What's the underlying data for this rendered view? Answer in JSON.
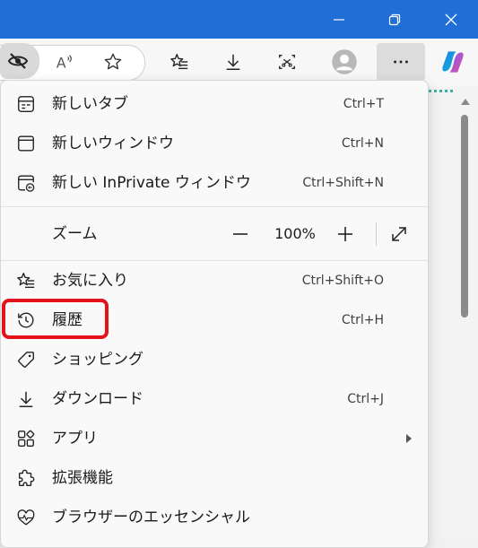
{
  "window": {
    "titlebar_color": "#1f6fd6",
    "buttons": [
      "minimize",
      "restore",
      "close"
    ]
  },
  "toolbar": {
    "icons": [
      "tracking-eye-icon",
      "read-aloud-icon",
      "favorite-star-icon",
      "favorites-list-icon",
      "download-icon",
      "screenshot-icon",
      "profile-avatar-icon",
      "more-options-icon",
      "copilot-icon"
    ],
    "read_aloud_label": "A"
  },
  "menu": {
    "items_top": [
      {
        "label": "新しいタブ",
        "shortcut": "Ctrl+T",
        "icon": "new-tab-icon"
      },
      {
        "label": "新しいウィンドウ",
        "shortcut": "Ctrl+N",
        "icon": "new-window-icon"
      },
      {
        "label": "新しい InPrivate ウィンドウ",
        "shortcut": "Ctrl+Shift+N",
        "icon": "inprivate-window-icon"
      }
    ],
    "zoom": {
      "label": "ズーム",
      "value": "100%"
    },
    "items_bottom": [
      {
        "label": "お気に入り",
        "shortcut": "Ctrl+Shift+O",
        "icon": "favorites-icon"
      },
      {
        "label": "履歴",
        "shortcut": "Ctrl+H",
        "icon": "history-icon"
      },
      {
        "label": "ショッピング",
        "shortcut": "",
        "icon": "shopping-tag-icon"
      },
      {
        "label": "ダウンロード",
        "shortcut": "Ctrl+J",
        "icon": "download-icon"
      },
      {
        "label": "アプリ",
        "shortcut": "",
        "icon": "apps-icon",
        "submenu": true
      },
      {
        "label": "拡張機能",
        "shortcut": "",
        "icon": "extensions-icon"
      },
      {
        "label": "ブラウザーのエッセンシャル",
        "shortcut": "",
        "icon": "browser-essentials-icon"
      }
    ],
    "highlight_color": "#e4141b"
  }
}
